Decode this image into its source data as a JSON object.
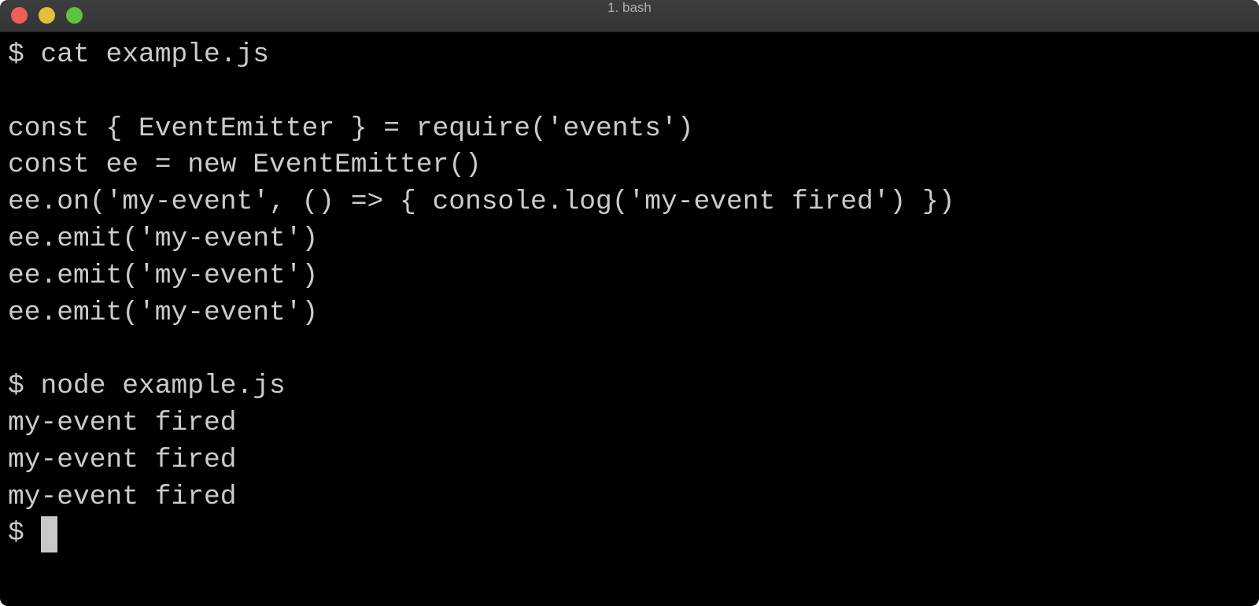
{
  "window": {
    "title": "1. bash",
    "traffic_lights": {
      "close": "#ee5f57",
      "minimize": "#e5bf3c",
      "zoom": "#5dc240"
    }
  },
  "terminal": {
    "lines": [
      "$ cat example.js",
      "",
      "const { EventEmitter } = require('events')",
      "const ee = new EventEmitter()",
      "ee.on('my-event', () => { console.log('my-event fired') })",
      "ee.emit('my-event')",
      "ee.emit('my-event')",
      "ee.emit('my-event')",
      "",
      "$ node example.js",
      "my-event fired",
      "my-event fired",
      "my-event fired"
    ],
    "prompt": "$ "
  }
}
